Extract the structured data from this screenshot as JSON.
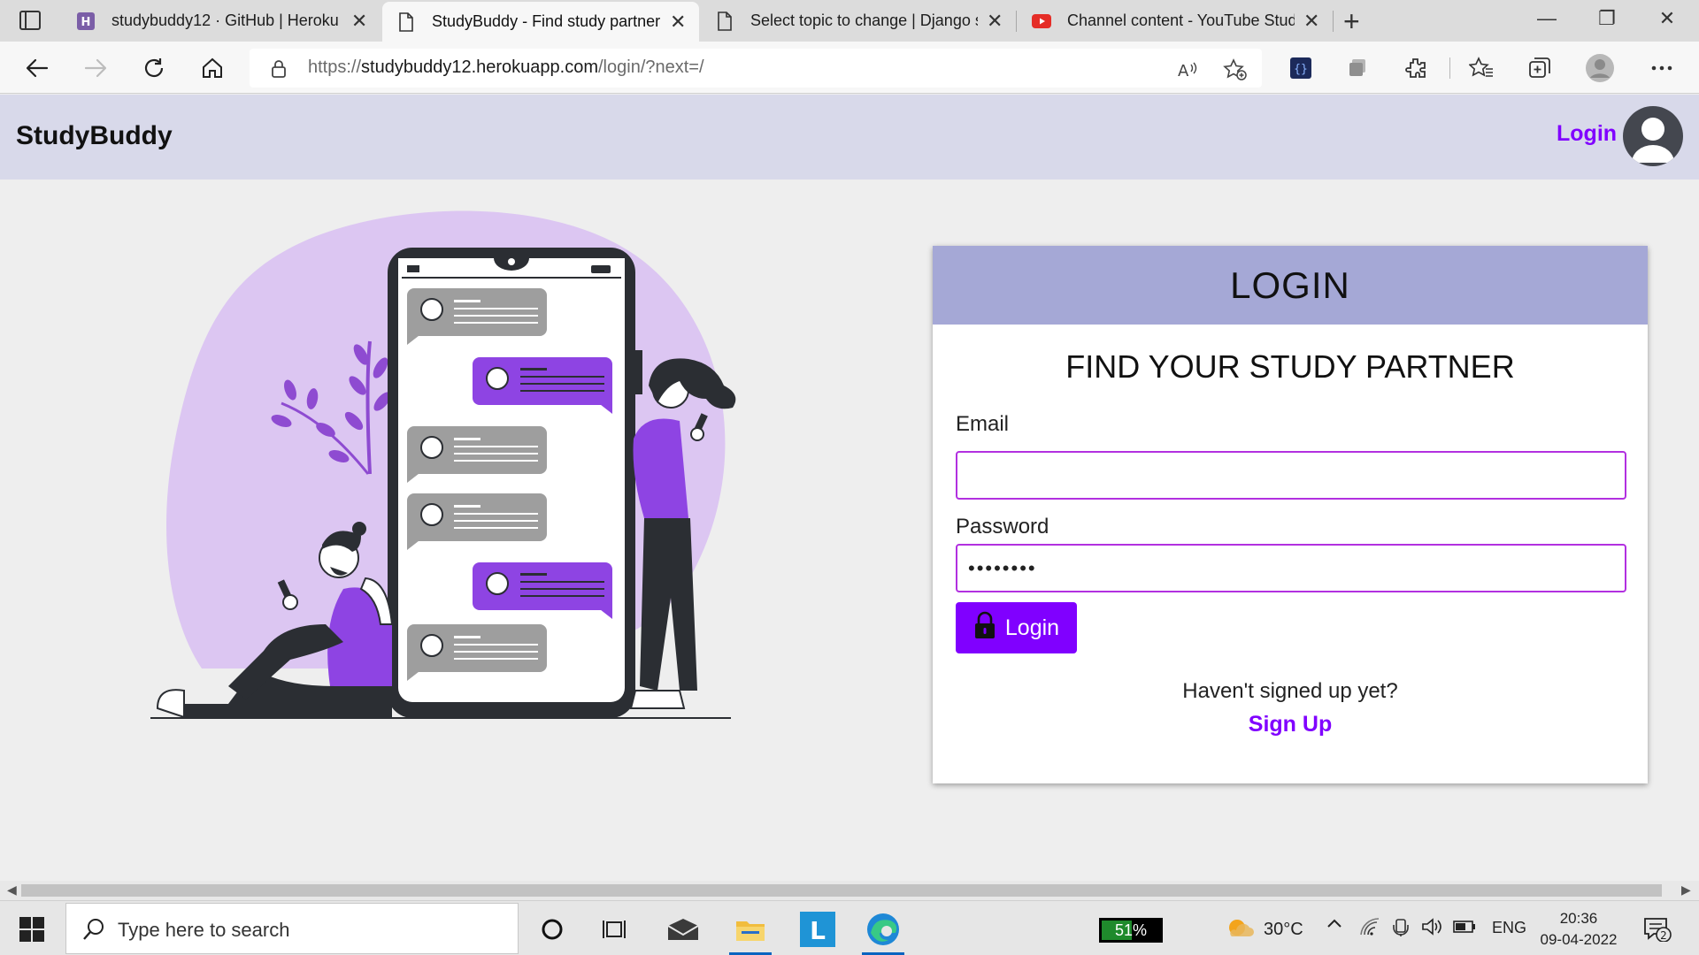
{
  "browser": {
    "tabs": [
      {
        "title": "studybuddy12 · GitHub | Heroku",
        "active": false,
        "favicon": "heroku-icon"
      },
      {
        "title": "StudyBuddy - Find study partner",
        "active": true,
        "favicon": "page-icon"
      },
      {
        "title": "Select topic to change | Django s",
        "active": false,
        "favicon": "page-icon"
      },
      {
        "title": "Channel content - YouTube Studi",
        "active": false,
        "favicon": "youtube-icon"
      }
    ],
    "url": {
      "scheme": "https://",
      "host": "studybuddy12.herokuapp.com",
      "path": "/login/?next=/"
    }
  },
  "site": {
    "brand": "StudyBuddy",
    "header_login": "Login"
  },
  "login_form": {
    "heading": "LOGIN",
    "subheading": "FIND YOUR STUDY PARTNER",
    "email_label": "Email",
    "email_value": "",
    "password_label": "Password",
    "password_value": "••••••••",
    "submit_label": "Login",
    "signup_prompt": "Haven't signed up yet?",
    "signup_link": "Sign Up"
  },
  "taskbar": {
    "search_placeholder": "Type here to search",
    "battery_percent": 51,
    "battery_label": "51%",
    "temperature": "30°C",
    "language": "ENG",
    "time": "20:36",
    "date": "09-04-2022",
    "notification_count": "2"
  },
  "colors": {
    "accent": "#8000ff",
    "header_bg": "#d8d9ea",
    "card_head_bg": "#a5a8d6",
    "input_border": "#b230e0"
  }
}
